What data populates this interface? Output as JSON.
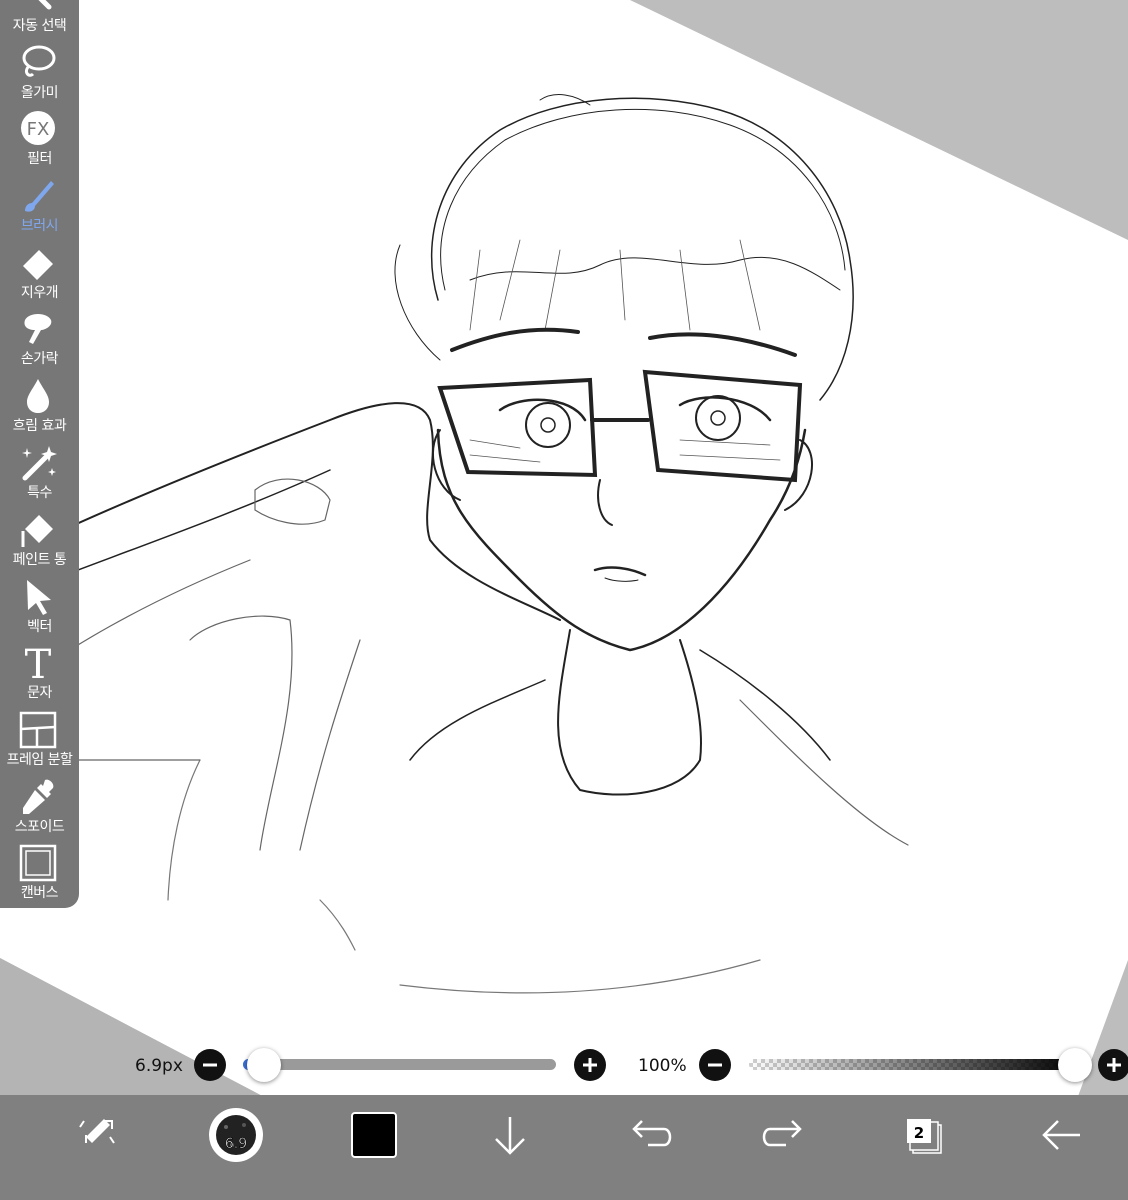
{
  "toolbar": {
    "tools": [
      {
        "label": "자동 선택",
        "icon": "magic-wand-icon"
      },
      {
        "label": "올가미",
        "icon": "lasso-icon"
      },
      {
        "label": "필터",
        "icon": "fx-icon",
        "icon_text": "FX"
      },
      {
        "label": "브러시",
        "icon": "brush-icon",
        "active": true
      },
      {
        "label": "지우개",
        "icon": "eraser-icon"
      },
      {
        "label": "손가락",
        "icon": "finger-icon"
      },
      {
        "label": "흐림 효과",
        "icon": "blur-drop-icon"
      },
      {
        "label": "특수",
        "icon": "special-wand-icon"
      },
      {
        "label": "페인트 통",
        "icon": "paint-bucket-icon"
      },
      {
        "label": "벡터",
        "icon": "vector-arrow-icon"
      },
      {
        "label": "문자",
        "icon": "text-icon",
        "icon_text": "T"
      },
      {
        "label": "프레임 분할",
        "icon": "frame-divide-icon"
      },
      {
        "label": "스포이드",
        "icon": "eyedropper-icon"
      },
      {
        "label": "캔버스",
        "icon": "canvas-icon"
      }
    ],
    "active_color": "#7fa7ee"
  },
  "brush_size": {
    "value": "6.9px",
    "level": 0.02
  },
  "opacity": {
    "value": "100%",
    "level": 1.0
  },
  "bottom_bar": {
    "brush_preview_size": "6.9",
    "current_color": "#000000",
    "layer_count": "2",
    "items": [
      "transform-icon",
      "brush-preview-icon",
      "color-swatch",
      "download-icon",
      "undo-icon",
      "redo-icon",
      "layers-icon",
      "back-arrow-icon"
    ]
  }
}
